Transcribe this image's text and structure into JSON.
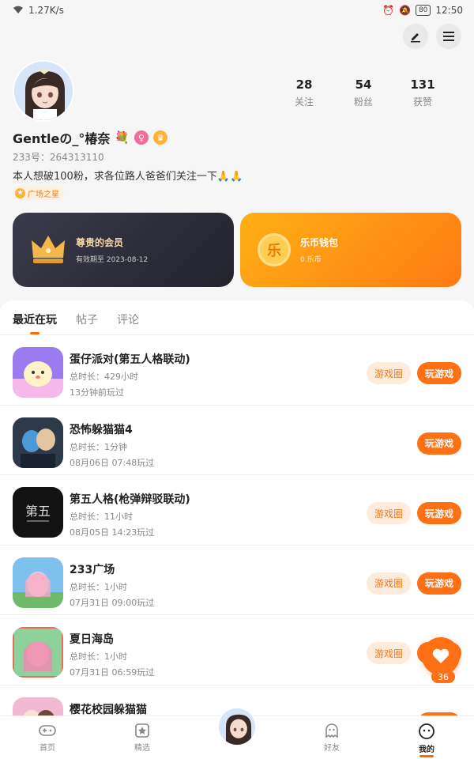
{
  "status_bar": {
    "net_speed": "1.27K/s",
    "battery": "80",
    "time": "12:50"
  },
  "profile": {
    "name": "Gentleの_°椿奈",
    "flower_emoji": "💐",
    "id_text": "233号：264313110",
    "bio": "本人想破100粉，求各位路人爸爸们关注一下🙏🙏",
    "tag": "广场之星",
    "stats": [
      {
        "value": "28",
        "label": "关注"
      },
      {
        "value": "54",
        "label": "粉丝"
      },
      {
        "value": "131",
        "label": "获赞"
      }
    ]
  },
  "cards": {
    "vip": {
      "title": "尊贵的会员",
      "sub": "有效期至 2023-08-12"
    },
    "wallet": {
      "icon_char": "乐",
      "title": "乐币钱包",
      "sub": "0 乐币"
    }
  },
  "tabs": [
    "最近在玩",
    "帖子",
    "评论"
  ],
  "buttons": {
    "circle": "游戏圈",
    "play": "玩游戏"
  },
  "games": [
    {
      "name": "蛋仔派对(第五人格联动)",
      "duration": "总时长：429小时",
      "last": "13分钟前玩过",
      "has_circle": true
    },
    {
      "name": "恐怖躲猫猫4",
      "duration": "总时长：1分钟",
      "last": "08月06日 07:48玩过",
      "has_circle": false
    },
    {
      "name": "第五人格(枪弹辩驳联动)",
      "duration": "总时长：11小时",
      "last": "08月05日 14:23玩过",
      "has_circle": true
    },
    {
      "name": "233广场",
      "duration": "总时长：1小时",
      "last": "07月31日 09:00玩过",
      "has_circle": true
    },
    {
      "name": "夏日海岛",
      "duration": "总时长：1小时",
      "last": "07月31日 06:59玩过",
      "has_circle": true
    },
    {
      "name": "樱花校园躲猫猫",
      "duration": "",
      "last": "",
      "has_circle": false
    }
  ],
  "like_count": "36",
  "nav": {
    "home": "首页",
    "featured": "精选",
    "friends": "好友",
    "mine": "我的"
  },
  "colors": {
    "accent": "#ff6f14",
    "wallet": "#ff9314",
    "vip_bg": "#2a2a36"
  }
}
